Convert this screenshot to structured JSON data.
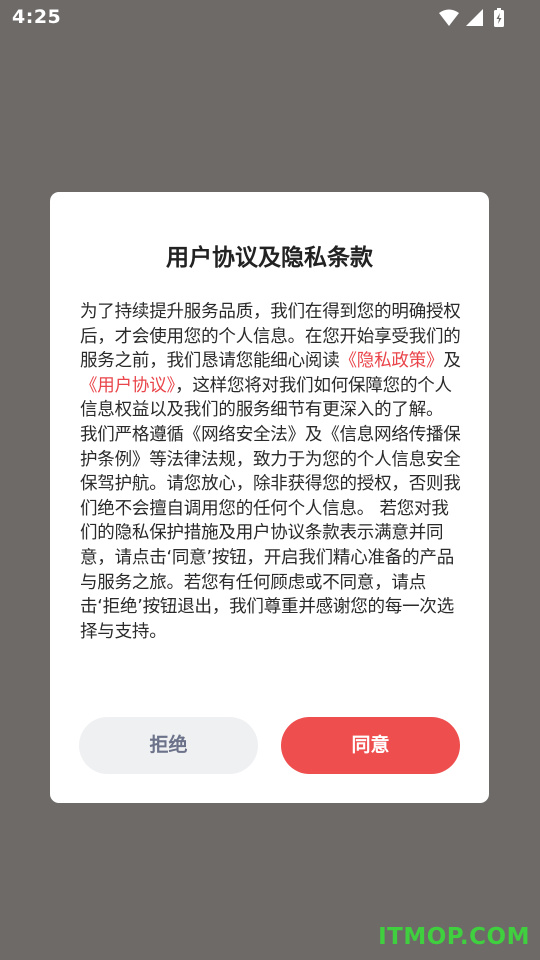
{
  "status_bar": {
    "time": "4:25",
    "icons": [
      "wifi-icon",
      "signal-icon",
      "battery-charging-icon"
    ]
  },
  "dialog": {
    "title": "用户协议及隐私条款",
    "body": {
      "p1": "为了持续提升服务品质，我们在得到您的明确授权后，才会使用您的个人信息。在您开始享受我们的服务之前，我们恳请您能细心阅读",
      "privacy_link": "《隐私政策》",
      "p2": "及",
      "user_agreement_link": "《用户协议》",
      "p3": "，这样您将对我们如何保障您的个人信息权益以及我们的服务细节有更深入的了解。 我们严格遵循《网络安全法》及《信息网络传播保护条例》等法律法规，致力于为您的个人信息安全保驾护航。请您放心，除非获得您的授权，否则我们绝不会擅自调用您的任何个人信息。 若您对我们的隐私保护措施及用户协议条款表示满意并同意，请点击‘同意’按钮，开启我们精心准备的产品与服务之旅。若您有任何顾虑或不同意，请点击‘拒绝’按钮退出，我们尊重并感谢您的每一次选择与支持。"
    },
    "buttons": {
      "decline": "拒绝",
      "agree": "同意"
    }
  },
  "colors": {
    "link": "#e9454a",
    "agree_button": "#ee4e4e",
    "decline_button": "#eff0f2",
    "backdrop": "#6d6a68"
  },
  "watermark": "ITMOP.COM"
}
